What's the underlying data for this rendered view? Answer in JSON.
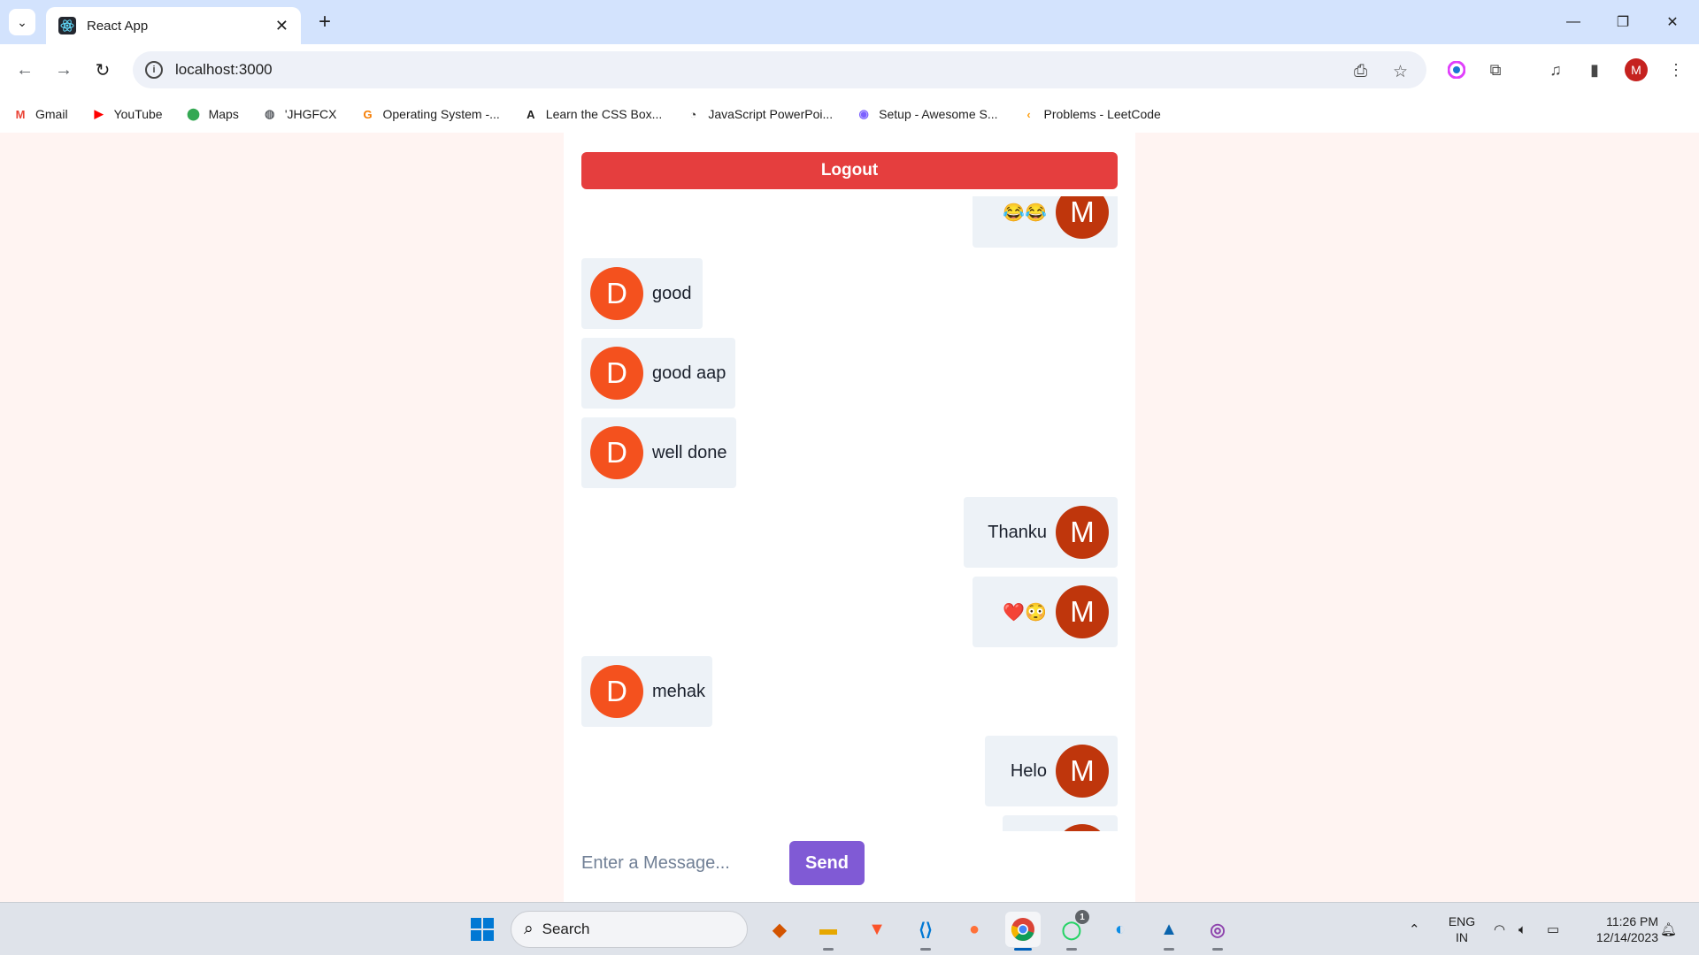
{
  "browser": {
    "tab_title": "React App",
    "url": "localhost:3000",
    "profile_initial": "M",
    "bookmarks": [
      {
        "label": "Gmail",
        "icon": "gmail-icon",
        "color": "#ea4335",
        "glyph": "M"
      },
      {
        "label": "YouTube",
        "icon": "youtube-icon",
        "color": "#ff0000",
        "glyph": "▶"
      },
      {
        "label": "Maps",
        "icon": "maps-icon",
        "color": "#34a853",
        "glyph": "⬤"
      },
      {
        "label": "'JHGFCX",
        "icon": "globe-icon",
        "color": "#5f6368",
        "glyph": "◍"
      },
      {
        "label": "Operating System -...",
        "icon": "geeks-icon",
        "color": "#f57c00",
        "glyph": "G"
      },
      {
        "label": "Learn the CSS Box...",
        "icon": "css-icon",
        "color": "#1a1a1a",
        "glyph": "A"
      },
      {
        "label": "JavaScript PowerPoi...",
        "icon": "timer-icon",
        "color": "#333333",
        "glyph": "◔"
      },
      {
        "label": "Setup - Awesome S...",
        "icon": "chrome-like-icon",
        "color": "#7b61ff",
        "glyph": "◉"
      },
      {
        "label": "Problems - LeetCode",
        "icon": "leetcode-icon",
        "color": "#ffa116",
        "glyph": "‹"
      }
    ]
  },
  "chat": {
    "logout_label": "Logout",
    "input_placeholder": "Enter a Message...",
    "send_label": "Send",
    "colors": {
      "left_avatar": "#f4511e",
      "right_avatar": "#bf360c",
      "bubble": "#edf2f7"
    },
    "messages": [
      {
        "side": "right",
        "initial": "M",
        "text": "😂😂"
      },
      {
        "side": "left",
        "initial": "D",
        "text": "good"
      },
      {
        "side": "left",
        "initial": "D",
        "text": "good aap"
      },
      {
        "side": "left",
        "initial": "D",
        "text": "well done"
      },
      {
        "side": "right",
        "initial": "M",
        "text": "Thanku"
      },
      {
        "side": "right",
        "initial": "M",
        "text": "❤️😳"
      },
      {
        "side": "left",
        "initial": "D",
        "text": "mehak"
      },
      {
        "side": "right",
        "initial": "M",
        "text": "Helo"
      },
      {
        "side": "right",
        "initial": "M",
        "text": ""
      }
    ]
  },
  "taskbar": {
    "search_label": "Search",
    "language": "ENG",
    "region": "IN",
    "time": "11:26 PM",
    "date": "12/14/2023",
    "whatsapp_badge": "1"
  }
}
